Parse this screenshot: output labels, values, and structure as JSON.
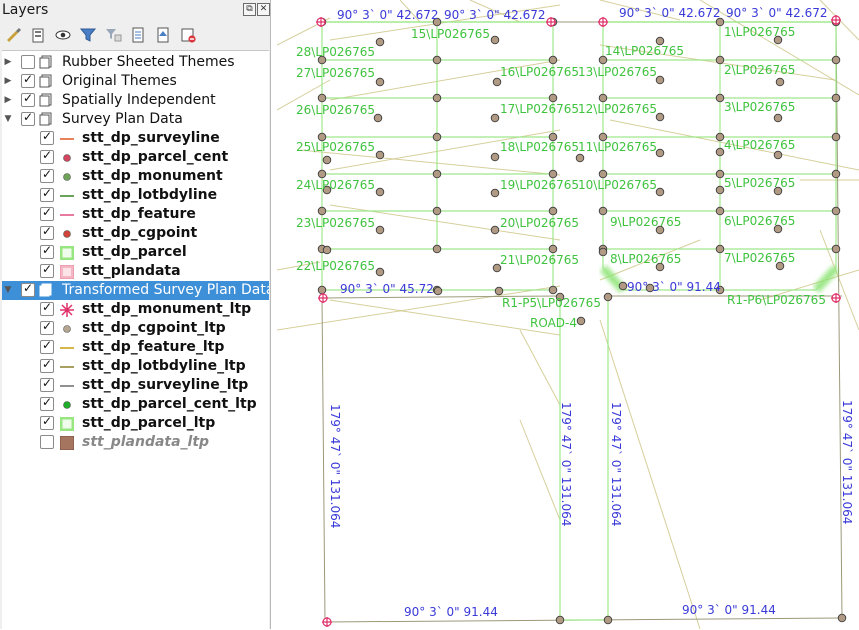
{
  "panel": {
    "title": "Layers",
    "float_label": "⧉",
    "close_label": "✕",
    "tools": [
      "style-manager-icon",
      "add-group-icon",
      "visibility-icon",
      "filter-icon",
      "filter-legend-icon",
      "expand-all-icon",
      "collapse-all-icon",
      "remove-layer-icon"
    ]
  },
  "tree": [
    {
      "type": "group",
      "label": "Rubber Sheeted Themes",
      "checked": false,
      "expanded": false,
      "selected": false
    },
    {
      "type": "group",
      "label": "Original Themes",
      "checked": true,
      "expanded": false,
      "selected": false
    },
    {
      "type": "group",
      "label": "Spatially Independent",
      "checked": true,
      "expanded": false,
      "selected": false
    },
    {
      "type": "group",
      "label": "Survey Plan Data",
      "checked": true,
      "expanded": true,
      "selected": false
    },
    {
      "type": "layer",
      "label": "stt_dp_surveyline",
      "checked": true,
      "symbol": "line",
      "color": "#e8825c"
    },
    {
      "type": "layer",
      "label": "stt_dp_parcel_cent",
      "checked": true,
      "symbol": "dot",
      "color": "#d2465f"
    },
    {
      "type": "layer",
      "label": "stt_dp_monument",
      "checked": true,
      "symbol": "dot",
      "color": "#6fa35a"
    },
    {
      "type": "layer",
      "label": "stt_dp_lotbdyline",
      "checked": true,
      "symbol": "line",
      "color": "#6aa35a"
    },
    {
      "type": "layer",
      "label": "stt_dp_feature",
      "checked": true,
      "symbol": "line",
      "color": "#e87aa0"
    },
    {
      "type": "layer",
      "label": "stt_dp_cgpoint",
      "checked": true,
      "symbol": "dot",
      "color": "#d0453a"
    },
    {
      "type": "layer",
      "label": "stt_dp_parcel",
      "checked": true,
      "symbol": "glow",
      "color": "#7ee062"
    },
    {
      "type": "layer",
      "label": "stt_plandata",
      "checked": true,
      "symbol": "pinkfill",
      "color": "#f4b6c2"
    },
    {
      "type": "group",
      "label": "Transformed Survey Plan Data",
      "checked": true,
      "expanded": true,
      "selected": true
    },
    {
      "type": "layer",
      "label": "stt_dp_monument_ltp",
      "checked": true,
      "symbol": "star",
      "color": "#e0306a"
    },
    {
      "type": "layer",
      "label": "stt_dp_cgpoint_ltp",
      "checked": true,
      "symbol": "dot",
      "color": "#b4a690"
    },
    {
      "type": "layer",
      "label": "stt_dp_feature_ltp",
      "checked": true,
      "symbol": "line",
      "color": "#d6b54a"
    },
    {
      "type": "layer",
      "label": "stt_dp_lotbdyline_ltp",
      "checked": true,
      "symbol": "line",
      "color": "#a8a060"
    },
    {
      "type": "layer",
      "label": "stt_dp_surveyline_ltp",
      "checked": true,
      "symbol": "line",
      "color": "#909090"
    },
    {
      "type": "layer",
      "label": "stt_dp_parcel_cent_ltp",
      "checked": true,
      "symbol": "dot",
      "color": "#1fae2a"
    },
    {
      "type": "layer",
      "label": "stt_dp_parcel_ltp",
      "checked": true,
      "symbol": "glow",
      "color": "#7ee062"
    },
    {
      "type": "layer",
      "label": "stt_plandata_ltp",
      "checked": false,
      "symbol": "brownfill",
      "color": "#a57560",
      "disabled": true
    }
  ],
  "map": {
    "parcel_glow": "#7ee062",
    "line_color": "#c8c07a",
    "vertex_fill": "#b09a84",
    "monument_color": "#e0306a",
    "bearing_color": "#3a3ad8",
    "label_color": "#3fc33f",
    "bearings": [
      "90° 3` 0\" 42.672",
      "90° 3` 0\" 42.672",
      "90° 3` 0\" 42.672",
      "90° 3` 0\" 42.672",
      "90° 3` 0\" 45.72",
      "90° 3` 0\" 91.44",
      "90° 3` 0\" 91.44",
      "90° 3` 0\" 91.44",
      "179° 47` 0\" 131.064",
      "179° 47` 0\" 131.064",
      "179° 47` 0\" 131.064",
      "179° 47` 0\" 131.064"
    ],
    "left_lots": [
      "28\\LP026765",
      "27\\LP026765",
      "26\\LP026765",
      "25\\LP026765",
      "24\\LP026765",
      "23\\LP026765",
      "22\\LP026765"
    ],
    "mid_lots": [
      "15\\LP026765",
      "16\\LP026765",
      "17\\LP026765",
      "18\\LP026765",
      "19\\LP026765",
      "20\\LP026765",
      "21\\LP026765"
    ],
    "mid2_lots": [
      "14\\LP026765",
      "13\\LP026765",
      "12\\LP026765",
      "11\\LP026765",
      "10\\LP026765",
      "9\\LP026765",
      "8\\LP026765"
    ],
    "right_lots": [
      "1\\LP026765",
      "2\\LP026765",
      "3\\LP026765",
      "4\\LP026765",
      "5\\LP026765",
      "6\\LP026765",
      "7\\LP026765"
    ],
    "reserve_labels": [
      "R1-P5\\LP026765",
      "R1-P6\\LP026765",
      "ROAD-4"
    ]
  }
}
